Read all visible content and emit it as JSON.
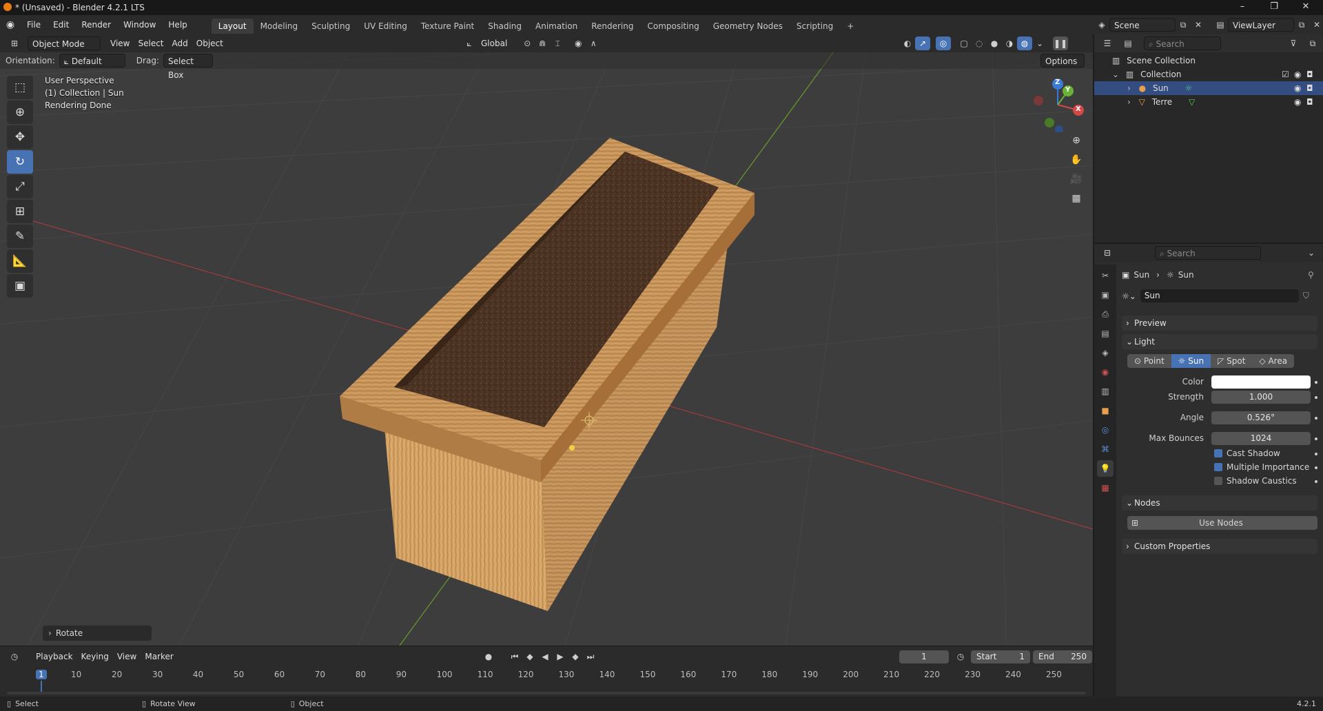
{
  "window": {
    "title": "* (Unsaved) - Blender 4.2.1 LTS",
    "controls": [
      "–",
      "❐",
      "✕"
    ]
  },
  "menu": [
    "File",
    "Edit",
    "Render",
    "Window",
    "Help"
  ],
  "workspaces": [
    "Layout",
    "Modeling",
    "Sculpting",
    "UV Editing",
    "Texture Paint",
    "Shading",
    "Animation",
    "Rendering",
    "Compositing",
    "Geometry Nodes",
    "Scripting"
  ],
  "workspace_add": "+",
  "scene": {
    "name": "Scene",
    "view_layer": "ViewLayer"
  },
  "viewport": {
    "mode": "Object Mode",
    "menus": [
      "View",
      "Select",
      "Add",
      "Object"
    ],
    "transform_orientation": "Global",
    "orientation_label": "Orientation:",
    "orientation_value": "Default",
    "drag_label": "Drag:",
    "drag_value": "Select Box",
    "options": "Options",
    "overlay_lines": [
      "User Perspective",
      "(1) Collection | Sun",
      "Rendering Done"
    ],
    "last_operator": "Rotate",
    "gizmo": {
      "x": "X",
      "y": "Y",
      "z": "Z"
    }
  },
  "timeline": {
    "menus": [
      "Playback",
      "Keying",
      "View",
      "Marker"
    ],
    "current_frame": "1",
    "start_label": "Start",
    "start": "1",
    "end_label": "End",
    "end": "250",
    "ticks": [
      "1",
      "10",
      "20",
      "30",
      "40",
      "50",
      "60",
      "70",
      "80",
      "90",
      "100",
      "110",
      "120",
      "130",
      "140",
      "150",
      "160",
      "170",
      "180",
      "190",
      "200",
      "210",
      "220",
      "230",
      "240",
      "250"
    ]
  },
  "statusbar": {
    "items": [
      "Select",
      "Rotate View",
      "Object"
    ],
    "version": "4.2.1"
  },
  "outliner": {
    "search_placeholder": "Search",
    "scene_collection": "Scene Collection",
    "collection": "Collection",
    "objects": [
      {
        "name": "Sun",
        "selected": true
      },
      {
        "name": "Terre",
        "selected": false
      }
    ]
  },
  "properties": {
    "search_placeholder": "Search",
    "breadcrumb": [
      "Sun",
      "Sun"
    ],
    "datablock": "Sun",
    "panels": {
      "preview": "Preview",
      "light": "Light",
      "nodes": "Nodes",
      "custom": "Custom Properties"
    },
    "light_types": [
      "Point",
      "Sun",
      "Spot",
      "Area"
    ],
    "active_light_type": "Sun",
    "fields": {
      "color_label": "Color",
      "strength_label": "Strength",
      "strength": "1.000",
      "angle_label": "Angle",
      "angle": "0.526°",
      "max_bounces_label": "Max Bounces",
      "max_bounces": "1024"
    },
    "checkboxes": [
      {
        "label": "Cast Shadow",
        "checked": true
      },
      {
        "label": "Multiple Importance",
        "checked": true
      },
      {
        "label": "Shadow Caustics",
        "checked": false
      }
    ],
    "use_nodes": "Use Nodes"
  },
  "colors": {
    "accent": "#4772b3",
    "selection": "#334d80",
    "viewport_bg": "#3d3d3d",
    "wood": "#c8955a",
    "soil": "#4a3322"
  }
}
